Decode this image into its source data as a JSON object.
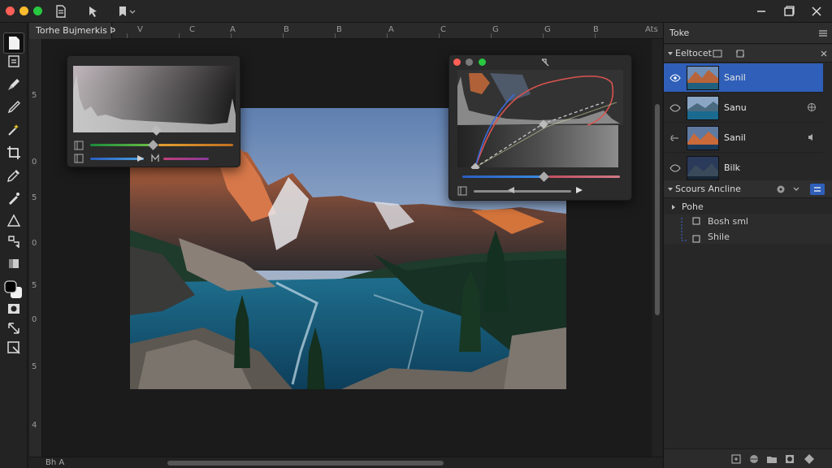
{
  "document_tab": "Torhe Bujmerkis Þ",
  "ruler": {
    "top_labels": [
      "V",
      "C",
      "A",
      "B",
      "B",
      "A",
      "C",
      "G",
      "G",
      "B",
      "Ats"
    ],
    "left_labels": [
      "5",
      "0",
      "5",
      "0",
      "5",
      "0",
      "5",
      "4"
    ]
  },
  "status": {
    "zoom": "Bh A"
  },
  "right_panel": {
    "title": "Toke",
    "layers_section": "Eeltocet",
    "layers": [
      {
        "name": "Sanil",
        "selected": true
      },
      {
        "name": "Sanu",
        "selected": false
      },
      {
        "name": "Sanil",
        "selected": false
      },
      {
        "name": "Bilk",
        "selected": false
      }
    ],
    "actions_section": "Scours Ancline",
    "actions_group": "Pohe",
    "actions": [
      "Bosh sml",
      "Shile"
    ]
  },
  "colors": {
    "accent": "#2f5fb8",
    "bg": "#1e1e1e",
    "traffic_red": "#ff5f57",
    "traffic_yellow": "#febc2e",
    "traffic_green": "#28c840"
  },
  "icons": {
    "titlebar": [
      "file-icon",
      "pointer-icon",
      "bookmark-icon",
      "chevron-down-icon"
    ],
    "window": [
      "minimize-icon",
      "restore-icon",
      "close-icon"
    ]
  }
}
